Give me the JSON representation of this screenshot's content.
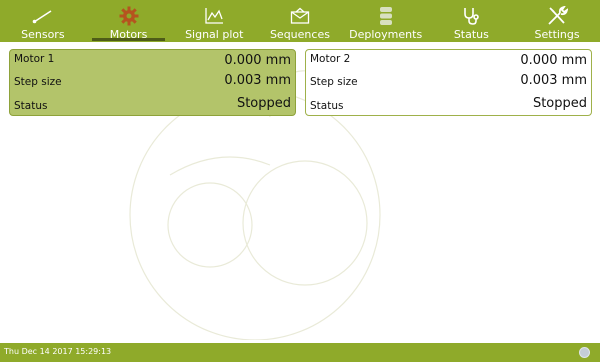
{
  "nav": {
    "tabs": [
      {
        "label": "Sensors",
        "icon": "wand-icon",
        "active": false
      },
      {
        "label": "Motors",
        "icon": "gear-icon",
        "active": true
      },
      {
        "label": "Signal plot",
        "icon": "chart-icon",
        "active": false
      },
      {
        "label": "Sequences",
        "icon": "envelope-icon",
        "active": false
      },
      {
        "label": "Deployments",
        "icon": "database-icon",
        "active": false
      },
      {
        "label": "Status",
        "icon": "stethoscope-icon",
        "active": false
      },
      {
        "label": "Settings",
        "icon": "tools-icon",
        "active": false
      }
    ]
  },
  "motor1": {
    "title": "Motor 1",
    "position": "0.000 mm",
    "step_label": "Step size",
    "step_value": "0.003 mm",
    "status_label": "Status",
    "status_value": "Stopped"
  },
  "motor2": {
    "title": "Motor 2",
    "position": "0.000 mm",
    "step_label": "Step size",
    "step_value": "0.003 mm",
    "status_label": "Status",
    "status_value": "Stopped"
  },
  "footer": {
    "datetime": "Thu Dec 14 2017 15:29:13"
  },
  "colors": {
    "bar": "#8faa2a",
    "active_panel": "#b3c46a",
    "active_icon": "#b5541f",
    "active_underline": "#4e5c18"
  }
}
